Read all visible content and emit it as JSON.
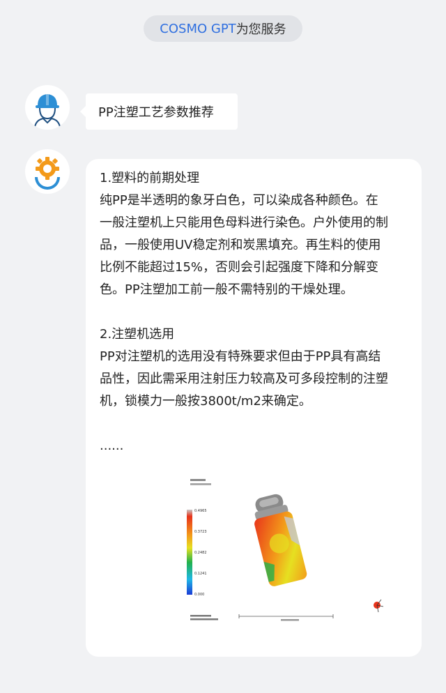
{
  "header": {
    "brand": "COSMO GPT",
    "suffix": "为您服务"
  },
  "user_message": {
    "text": "PP注塑工艺参数推荐",
    "avatar_icon": "worker-helmet-icon"
  },
  "bot_message": {
    "avatar_icon": "gear-logo-icon",
    "section1_title": "1.塑料的前期处理",
    "section1_lines": [
      "纯PP是半透明的象牙白色，可以染成各种颜色。在",
      "一般注塑机上只能用色母料进行染色。户外使用的制",
      "品，一般使用UV稳定剂和炭黑填充。再生料的使用",
      "比例不能超过15%，否则会引起强度下降和分解变",
      "色。PP注塑加工前一般不需特别的干燥处理。"
    ],
    "section2_title": "2.注塑机选用",
    "section2_lines": [
      "PP对注塑机的选用没有特殊要求但由于PP具有高结",
      "品性，因此需采用注射压力较高及可多段控制的注塑",
      "机，锁模力一般按3800t/m2来确定。"
    ],
    "ellipsis": "......"
  },
  "simulation_figure": {
    "legend_values": [
      "0.4965",
      "0.3723",
      "0.2482",
      "0.1241",
      "0.000"
    ],
    "colors": {
      "brand_blue": "#2f6fe0",
      "legend_top": "#c8c8c8",
      "legend_red": "#e8331b",
      "legend_orange": "#f39a1a",
      "legend_yellow": "#e6e021",
      "legend_green": "#22b14c",
      "legend_cyan": "#1fb7e6",
      "legend_blue": "#1a3bd6"
    }
  }
}
